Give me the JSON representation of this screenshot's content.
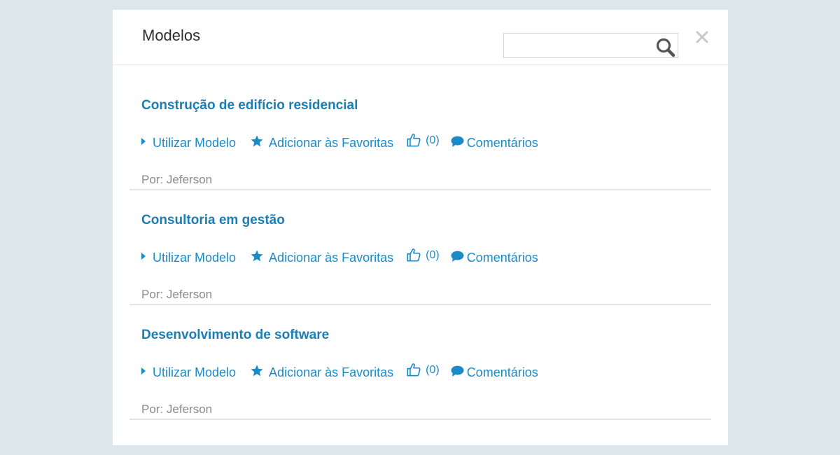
{
  "modal": {
    "title": "Modelos",
    "search": {
      "value": "",
      "placeholder": ""
    },
    "icons": {
      "search": "search-icon",
      "close": "close-icon"
    }
  },
  "actions": {
    "use_label": "Utilizar Modelo",
    "favorite_label": "Adicionar às Favoritas",
    "comments_label": "Comentários",
    "author_prefix": "Por: "
  },
  "templates": [
    {
      "title": "Construção de edifício residencial",
      "likes": "(0)",
      "author": "Por: Jeferson"
    },
    {
      "title": "Consultoria em gestão",
      "likes": "(0)",
      "author": "Por: Jeferson"
    },
    {
      "title": "Desenvolvimento de software",
      "likes": "(0)",
      "author": "Por: Jeferson"
    }
  ],
  "colors": {
    "background": "#dde6ea",
    "accent": "#1b7db3",
    "link": "#1b8ac8",
    "muted": "#8a8a8a"
  }
}
